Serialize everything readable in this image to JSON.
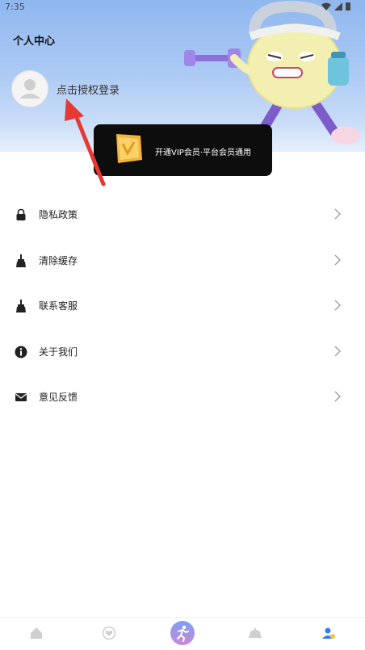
{
  "status_bar": {
    "time": "7:35"
  },
  "header": {
    "title": "个人中心",
    "login_prompt": "点击授权登录"
  },
  "vip_banner": {
    "text": "开通VIP会员·平台会员通用"
  },
  "menu": {
    "items": [
      {
        "label": "隐私政策",
        "icon": "lock-icon"
      },
      {
        "label": "清除缓存",
        "icon": "broom-icon"
      },
      {
        "label": "联系客服",
        "icon": "broom-icon"
      },
      {
        "label": "关于我们",
        "icon": "info-icon"
      },
      {
        "label": "意见反馈",
        "icon": "mail-icon"
      }
    ]
  },
  "tabbar": {
    "items": [
      {
        "icon": "home-icon"
      },
      {
        "icon": "heart-icon"
      },
      {
        "icon": "running-icon"
      },
      {
        "icon": "dish-icon"
      },
      {
        "icon": "profile-icon"
      }
    ]
  },
  "colors": {
    "header_gradient_top": "#8fb7ee",
    "vip_card": "#0d0d0d",
    "arrow": "#e53935",
    "active_tab": "#3a7bf0"
  }
}
